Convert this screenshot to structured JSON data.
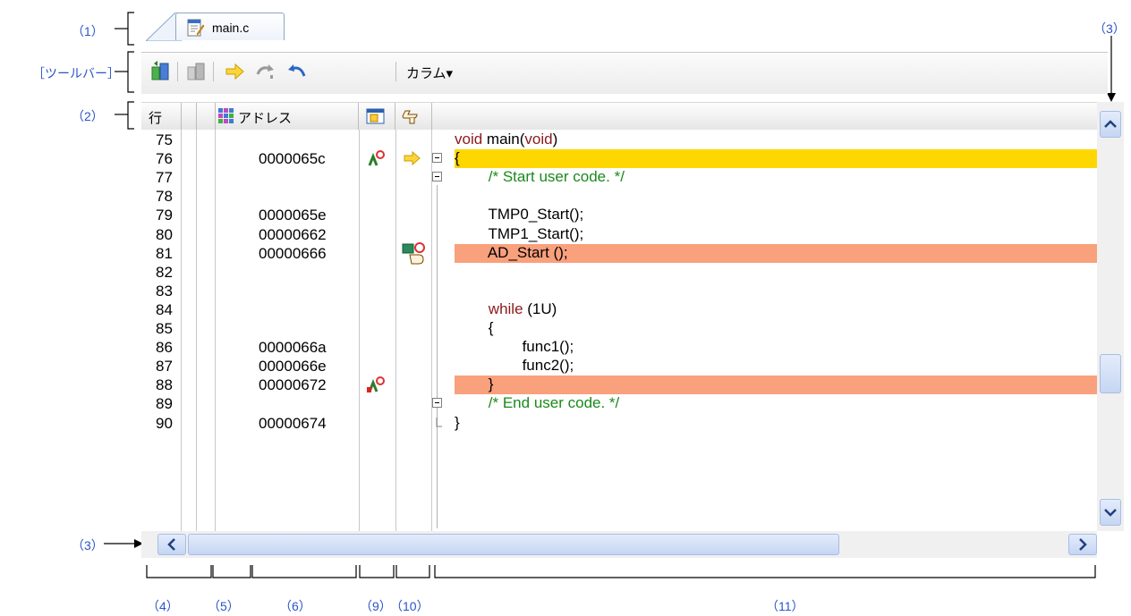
{
  "callouts": {
    "c1": "（1）",
    "toolbar": "［ツールバー］",
    "c2": "（2）",
    "c3_top": "（3）",
    "c3_left": "（3）",
    "c4": "（4）",
    "c5": "（5）",
    "c6": "（6）",
    "c9": "（9）",
    "c10": "（10）",
    "c11": "（11）"
  },
  "tab": {
    "label": "main.c"
  },
  "toolbar": {
    "column_menu": "カラム▾"
  },
  "header": {
    "line": "行",
    "address": "アドレス"
  },
  "rows": [
    {
      "line": "75",
      "addr": "",
      "code": "void main(void)",
      "hl": "",
      "fold": "",
      "marker": ""
    },
    {
      "line": "76",
      "addr": "0000065c",
      "code": "{",
      "hl": "y",
      "fold": "minus",
      "marker": "bp-run"
    },
    {
      "line": "77",
      "addr": "",
      "code": "        /* Start user code. */",
      "hl": "",
      "fold": "minus",
      "marker": ""
    },
    {
      "line": "78",
      "addr": "",
      "code": "",
      "hl": "",
      "fold": "",
      "marker": ""
    },
    {
      "line": "79",
      "addr": "0000065e",
      "code": "        TMP0_Start();",
      "hl": "",
      "fold": "",
      "marker": ""
    },
    {
      "line": "80",
      "addr": "00000662",
      "code": "        TMP1_Start();",
      "hl": "",
      "fold": "",
      "marker": ""
    },
    {
      "line": "81",
      "addr": "00000666",
      "code": "        AD_Start ();",
      "hl": "r",
      "fold": "",
      "marker": "hand"
    },
    {
      "line": "82",
      "addr": "",
      "code": "",
      "hl": "",
      "fold": "",
      "marker": ""
    },
    {
      "line": "83",
      "addr": "",
      "code": "",
      "hl": "",
      "fold": "",
      "marker": ""
    },
    {
      "line": "84",
      "addr": "",
      "code": "        while (1U)",
      "hl": "",
      "fold": "",
      "marker": ""
    },
    {
      "line": "85",
      "addr": "",
      "code": "        {",
      "hl": "",
      "fold": "",
      "marker": ""
    },
    {
      "line": "86",
      "addr": "0000066a",
      "code": "                func1();",
      "hl": "",
      "fold": "",
      "marker": ""
    },
    {
      "line": "87",
      "addr": "0000066e",
      "code": "                func2();",
      "hl": "",
      "fold": "",
      "marker": ""
    },
    {
      "line": "88",
      "addr": "00000672",
      "code": "        }",
      "hl": "r",
      "fold": "",
      "marker": "bp"
    },
    {
      "line": "89",
      "addr": "",
      "code": "        /* End user code. */",
      "hl": "",
      "fold": "minus",
      "marker": ""
    },
    {
      "line": "90",
      "addr": "00000674",
      "code": "}",
      "hl": "",
      "fold": "end",
      "marker": ""
    }
  ],
  "colors": {
    "current_line": "#ffd700",
    "breakpoint_line": "#f9a07c",
    "keyword": "#8b1a1a",
    "comment": "#1a8a1a",
    "callout": "#2a55c8"
  }
}
